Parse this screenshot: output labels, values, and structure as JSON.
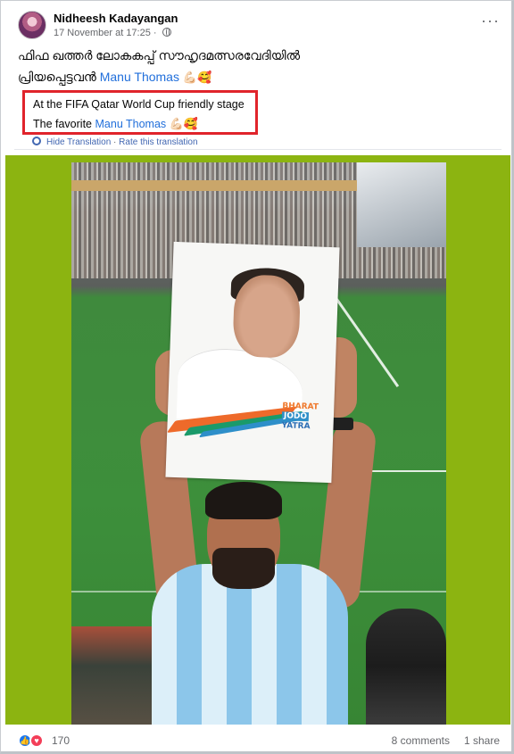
{
  "post": {
    "author": "Nidheesh Kadayangan",
    "timestamp": "17 November at 17:25",
    "privacy_icon": "globe-icon",
    "more_label": "···",
    "text_line1": "ഫിഫ ഖത്തർ ലോകകപ്പ് സൗഹൃദമത്സരവേദിയിൽ",
    "text_line2_prefix": "പ്രിയപ്പെട്ടവൻ",
    "mention": "Manu Thomas",
    "emojis": "💪🏻🥰"
  },
  "translation": {
    "line1": "At the FIFA Qatar World Cup friendly stage",
    "line2_prefix": "The favorite",
    "mention": "Manu Thomas",
    "emojis": "💪🏻🥰",
    "hide_label": "Hide Translation",
    "separator": "·",
    "rate_label": "Rate this translation"
  },
  "photo": {
    "placard_text_1": "BHARAT",
    "placard_text_2": "JODO",
    "placard_text_3": "YATRA"
  },
  "footer": {
    "reactions_count": "170",
    "comments": "8 comments",
    "shares": "1 share",
    "like_icon": "👍",
    "love_icon": "♥"
  },
  "colors": {
    "accent": "#216fdb",
    "highlight_box": "#e0242b",
    "photo_background": "#8cb411"
  }
}
